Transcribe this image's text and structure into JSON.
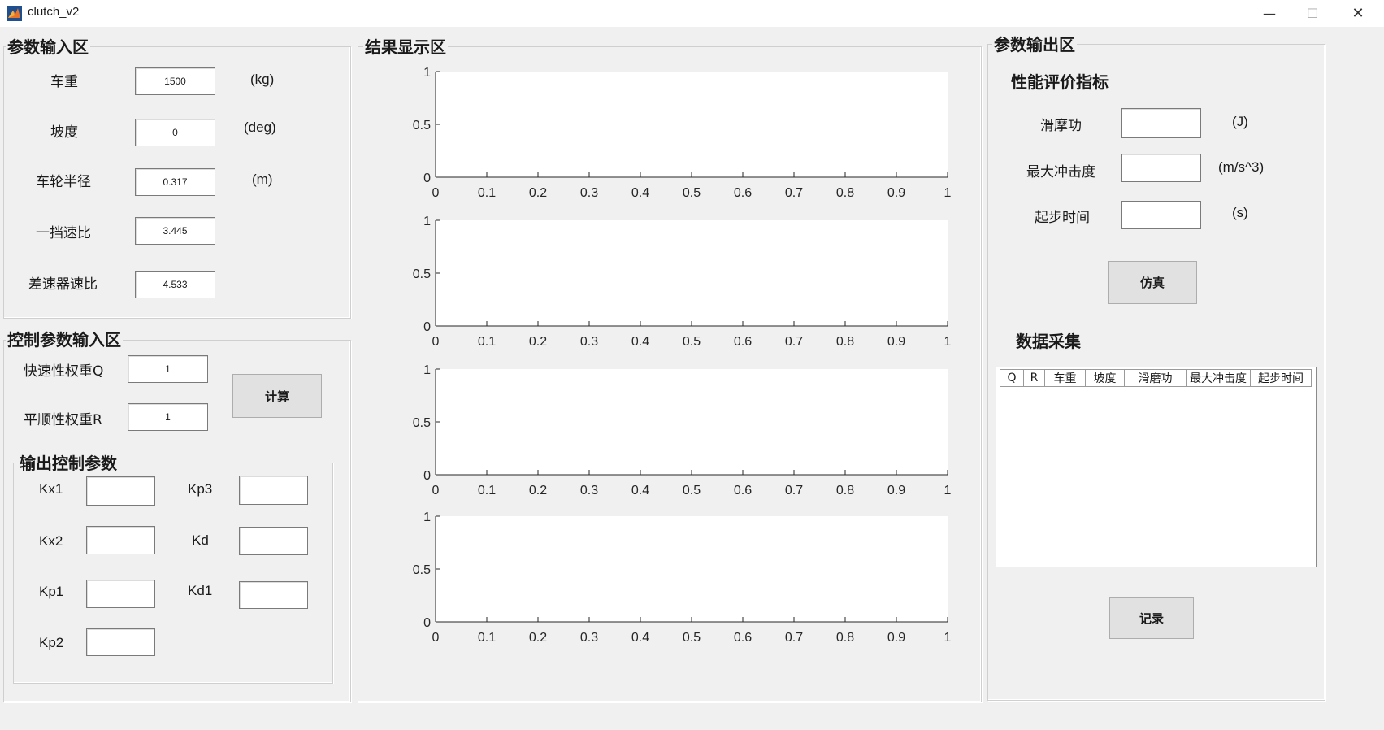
{
  "window": {
    "title": "clutch_v2",
    "minimize_glyph": "—",
    "maximize_glyph": "☐",
    "close_glyph": "✕"
  },
  "param_input": {
    "title": "参数输入区",
    "rows": [
      {
        "label": "车重",
        "value": "1500",
        "unit": "(kg)"
      },
      {
        "label": "坡度",
        "value": "0",
        "unit": "(deg)"
      },
      {
        "label": "车轮半径",
        "value": "0.317",
        "unit": "(m)"
      },
      {
        "label": "一挡速比",
        "value": "3.445",
        "unit": ""
      },
      {
        "label": "差速器速比",
        "value": "4.533",
        "unit": ""
      }
    ]
  },
  "control_input": {
    "title": "控制参数输入区",
    "q_label": "快速性权重Q",
    "q_value": "1",
    "r_label": "平顺性权重R",
    "r_value": "1",
    "calc_button": "计算"
  },
  "control_output": {
    "title": "输出控制参数",
    "fields": [
      {
        "label": "Kx1",
        "value": ""
      },
      {
        "label": "Kx2",
        "value": ""
      },
      {
        "label": "Kp1",
        "value": ""
      },
      {
        "label": "Kp2",
        "value": ""
      },
      {
        "label": "Kp3",
        "value": ""
      },
      {
        "label": "Kd",
        "value": ""
      },
      {
        "label": "Kd1",
        "value": ""
      }
    ]
  },
  "results": {
    "title": "结果显示区"
  },
  "chart_data": [
    {
      "type": "line",
      "series": [],
      "xlim": [
        0,
        1
      ],
      "ylim": [
        0,
        1
      ],
      "xticks": [
        "0",
        "0.1",
        "0.2",
        "0.3",
        "0.4",
        "0.5",
        "0.6",
        "0.7",
        "0.8",
        "0.9",
        "1"
      ],
      "yticks": [
        "0",
        "0.5",
        "1"
      ],
      "grid": false
    },
    {
      "type": "line",
      "series": [],
      "xlim": [
        0,
        1
      ],
      "ylim": [
        0,
        1
      ],
      "xticks": [
        "0",
        "0.1",
        "0.2",
        "0.3",
        "0.4",
        "0.5",
        "0.6",
        "0.7",
        "0.8",
        "0.9",
        "1"
      ],
      "yticks": [
        "0",
        "0.5",
        "1"
      ],
      "grid": false
    },
    {
      "type": "line",
      "series": [],
      "xlim": [
        0,
        1
      ],
      "ylim": [
        0,
        1
      ],
      "xticks": [
        "0",
        "0.1",
        "0.2",
        "0.3",
        "0.4",
        "0.5",
        "0.6",
        "0.7",
        "0.8",
        "0.9",
        "1"
      ],
      "yticks": [
        "0",
        "0.5",
        "1"
      ],
      "grid": false
    },
    {
      "type": "line",
      "series": [],
      "xlim": [
        0,
        1
      ],
      "ylim": [
        0,
        1
      ],
      "xticks": [
        "0",
        "0.1",
        "0.2",
        "0.3",
        "0.4",
        "0.5",
        "0.6",
        "0.7",
        "0.8",
        "0.9",
        "1"
      ],
      "yticks": [
        "0",
        "0.5",
        "1"
      ],
      "grid": false
    }
  ],
  "param_output": {
    "title": "参数输出区",
    "perf_title": "性能评价指标",
    "metrics": [
      {
        "label": "滑摩功",
        "value": "",
        "unit": "(J)"
      },
      {
        "label": "最大冲击度",
        "value": "",
        "unit": "(m/s^3)"
      },
      {
        "label": "起步时间",
        "value": "",
        "unit": "(s)"
      }
    ],
    "sim_button": "仿真",
    "data_title": "数据采集",
    "table_columns": [
      "Q",
      "R",
      "车重",
      "坡度",
      "滑磨功",
      "最大冲击度",
      "起步时间"
    ],
    "record_button": "记录"
  }
}
